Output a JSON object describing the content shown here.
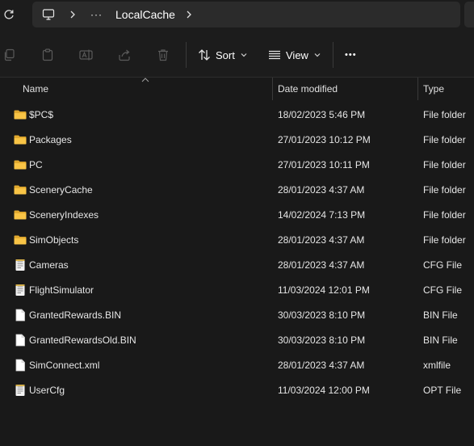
{
  "address": {
    "ellipsis": "···",
    "current": "LocalCache"
  },
  "toolbar": {
    "sort_label": "Sort",
    "view_label": "View",
    "more_label": "•••"
  },
  "columns": {
    "name": "Name",
    "date": "Date modified",
    "type": "Type"
  },
  "files": [
    {
      "name": "$PC$",
      "date": "18/02/2023 5:46 PM",
      "type": "File folder",
      "icon": "folder"
    },
    {
      "name": "Packages",
      "date": "27/01/2023 10:12 PM",
      "type": "File folder",
      "icon": "folder"
    },
    {
      "name": "PC",
      "date": "27/01/2023 10:11 PM",
      "type": "File folder",
      "icon": "folder"
    },
    {
      "name": "SceneryCache",
      "date": "28/01/2023 4:37 AM",
      "type": "File folder",
      "icon": "folder"
    },
    {
      "name": "SceneryIndexes",
      "date": "14/02/2024 7:13 PM",
      "type": "File folder",
      "icon": "folder"
    },
    {
      "name": "SimObjects",
      "date": "28/01/2023 4:37 AM",
      "type": "File folder",
      "icon": "folder"
    },
    {
      "name": "Cameras",
      "date": "28/01/2023 4:37 AM",
      "type": "CFG File",
      "icon": "config-file"
    },
    {
      "name": "FlightSimulator",
      "date": "11/03/2024 12:01 PM",
      "type": "CFG File",
      "icon": "config-file"
    },
    {
      "name": "GrantedRewards.BIN",
      "date": "30/03/2023 8:10 PM",
      "type": "BIN File",
      "icon": "blank-file"
    },
    {
      "name": "GrantedRewardsOld.BIN",
      "date": "30/03/2023 8:10 PM",
      "type": "BIN File",
      "icon": "blank-file"
    },
    {
      "name": "SimConnect.xml",
      "date": "28/01/2023 4:37 AM",
      "type": "xmlfile",
      "icon": "blank-file"
    },
    {
      "name": "UserCfg",
      "date": "11/03/2024 12:00 PM",
      "type": "OPT File",
      "icon": "config-file"
    }
  ],
  "colors": {
    "folder": "#f8c446",
    "background": "#191919",
    "toolbar": "#1c1c1c"
  }
}
